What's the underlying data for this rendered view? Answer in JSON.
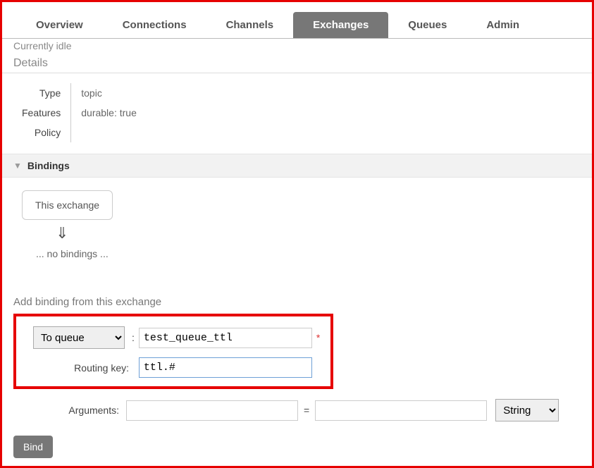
{
  "tabs": {
    "overview": "Overview",
    "connections": "Connections",
    "channels": "Channels",
    "exchanges": "Exchanges",
    "queues": "Queues",
    "admin": "Admin",
    "active": "exchanges"
  },
  "status_line": "Currently idle",
  "details": {
    "heading": "Details",
    "type_label": "Type",
    "type_value": "topic",
    "features_label": "Features",
    "features_value": "durable: true",
    "policy_label": "Policy",
    "policy_value": ""
  },
  "bindings": {
    "heading": "Bindings",
    "this_exchange": "This exchange",
    "arrow": "⇓",
    "none": "... no bindings ..."
  },
  "add_binding": {
    "heading": "Add binding from this exchange",
    "dest_select": "To queue",
    "dest_value": "test_queue_ttl",
    "routing_key_label": "Routing key:",
    "routing_key_value": "ttl.#",
    "required_mark": "*",
    "arguments_label": "Arguments:",
    "arguments_key": "",
    "equals": "=",
    "arguments_value": "",
    "type_select": "String",
    "submit": "Bind"
  }
}
